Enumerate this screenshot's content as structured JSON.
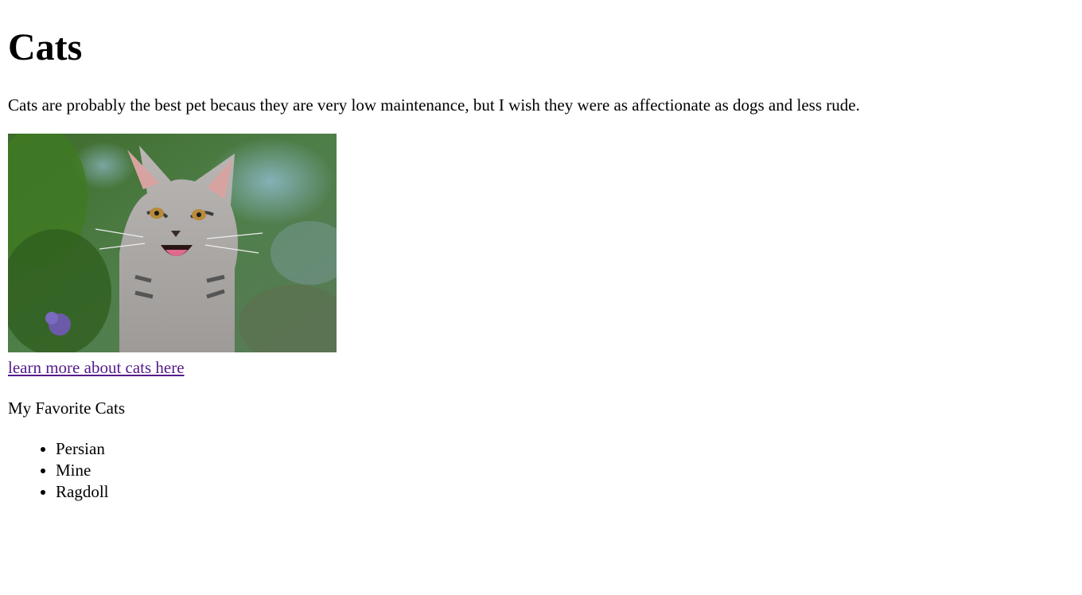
{
  "page": {
    "heading": "Cats",
    "intro": "Cats are probably the best pet becaus they are very low maintenance, but I wish they were as affectionate as dogs and less rude.",
    "image_subject": "kitten-photo",
    "link_text": "learn more about cats here",
    "favorites_title": "My Favorite Cats",
    "favorites": [
      "Persian",
      "Mine",
      "Ragdoll"
    ]
  },
  "colors": {
    "visited_link": "#551a8b",
    "text": "#000000",
    "background": "#ffffff"
  }
}
